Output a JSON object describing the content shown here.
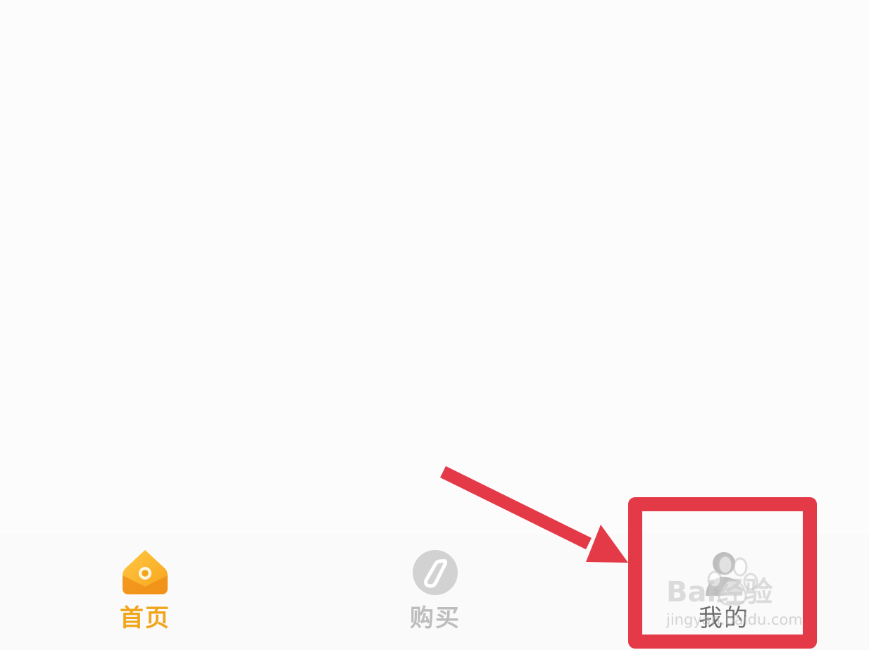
{
  "tab_bar": {
    "items": [
      {
        "label": "首页",
        "icon": "home-icon",
        "active": true,
        "color": "#f0a51b"
      },
      {
        "label": "购买",
        "icon": "compass-icon",
        "active": false,
        "color": "#bdbdbd"
      },
      {
        "label": "我的",
        "icon": "profile-icon",
        "active": false,
        "color": "#6f6f6f"
      }
    ]
  },
  "watermark": {
    "brand": "Bai经验",
    "url": "jingyan.baidu.com",
    "icon": "baidu-paw-icon"
  },
  "annotation": {
    "arrow_icon": "red-arrow-icon",
    "highlight_color": "#e43a48"
  }
}
